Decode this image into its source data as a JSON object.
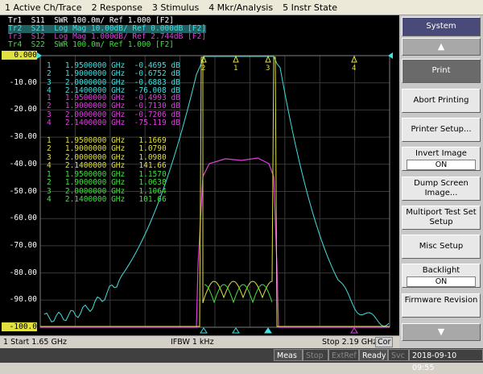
{
  "menu": [
    "1 Active Ch/Trace",
    "2 Response",
    "3 Stimulus",
    "4 Mkr/Analysis",
    "5 Instr State"
  ],
  "traces": [
    {
      "text": "Tr1  S11  SWR 100.0m/ Ref 1.000 [F2]",
      "color": "#ffffff"
    },
    {
      "text": "Tr2  S21  Log Mag 10.00dB/ Ref 0.000dB [F2]",
      "color": "#40e0e0"
    },
    {
      "text": "Tr3  S12  Log Mag 1.000dB/ Ref 2.744dB [F2]",
      "color": "#e040e0"
    },
    {
      "text": "Tr4  S22  SWR 100.0m/ Ref 1.000 [F2]",
      "color": "#40e040"
    }
  ],
  "y_axis": [
    "0.000",
    "-10.00",
    "-20.00",
    "-30.00",
    "-40.00",
    "-50.00",
    "-60.00",
    "-70.00",
    "-80.00",
    "-90.00",
    "-100.0"
  ],
  "marker_tables": [
    {
      "color": "#40e0e0",
      "rows": [
        "1   1.9500000 GHz  -0.4695 dB",
        "2   1.9000000 GHz  -0.6752 dB",
        "3   2.0000000 GHz  -0.6883 dB",
        "4   2.1400000 GHz  -76.008 dB"
      ]
    },
    {
      "color": "#e040e0",
      "rows": [
        "1   1.9500000 GHz  -0.4993 dB",
        "2   1.9000000 GHz  -0.7130 dB",
        "3   2.0000000 GHz  -0.7206 dB",
        "4   2.1400000 GHz  -75.119 dB"
      ]
    },
    {
      "color": "#e0e040",
      "rows": [
        "1   1.9500000 GHz   1.1669",
        "2   1.9000000 GHz   1.0790",
        "3   2.0000000 GHz   1.0980",
        "4   2.1400000 GHz   141.66"
      ]
    },
    {
      "color": "#40e040",
      "rows": [
        "1   1.9500000 GHz   1.1570",
        "2   1.9000000 GHz   1.0638",
        "3   2.0000000 GHz   1.1064",
        "4   2.1400000 GHz   101.66"
      ]
    }
  ],
  "status": {
    "start": "1  Start 1.65 GHz",
    "ifbw": "IFBW 1 kHz",
    "stop": "Stop 2.19 GHz",
    "cor": "Cor"
  },
  "bottom": {
    "meas": "Meas",
    "stop": "Stop",
    "extref": "ExtRef",
    "ready": "Ready",
    "svc": "Svc",
    "datetime": "2018-09-10 09:55"
  },
  "softkeys": {
    "title": "System",
    "print": "Print",
    "abort": "Abort Printing",
    "printer_setup": "Printer Setup...",
    "invert_image": "Invert Image",
    "invert_value": "ON",
    "dump": "Dump Screen Image...",
    "multiport": "Multiport Test Set Setup",
    "misc": "Misc Setup",
    "backlight": "Backlight",
    "backlight_value": "ON",
    "firmware": "Firmware Revision"
  },
  "marker_labels": {
    "m1": "1",
    "m2": "2",
    "m3": "3",
    "m4": "4"
  }
}
